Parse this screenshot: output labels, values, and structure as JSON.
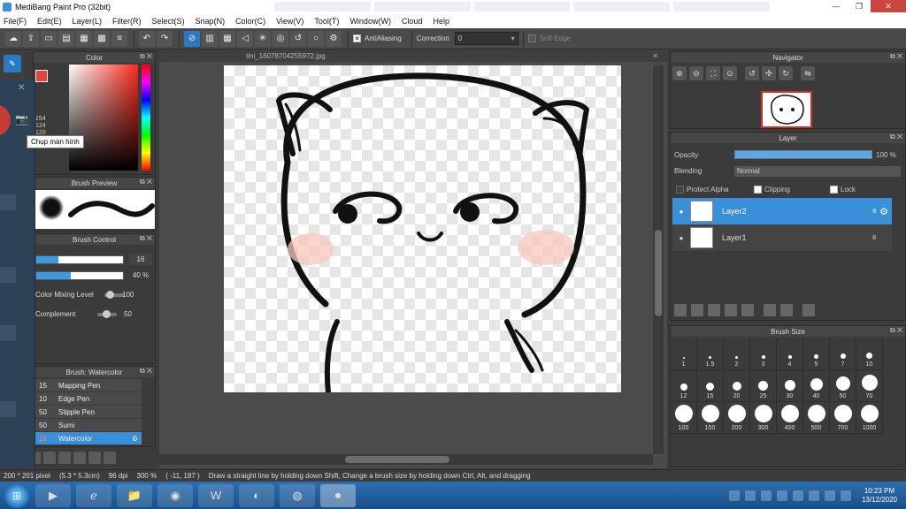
{
  "window": {
    "title": "MediBang Paint Pro (32bit)"
  },
  "menu": [
    "File(F)",
    "Edit(E)",
    "Layer(L)",
    "Filter(R)",
    "Select(S)",
    "Snap(N)",
    "Color(C)",
    "View(V)",
    "Tool(T)",
    "Window(W)",
    "Cloud",
    "Help"
  ],
  "toolbar": {
    "antialiasing_label": "AntiAliasing",
    "correction_label": "Correction",
    "correction_value": "0",
    "soft_edge_label": "Soft Edge"
  },
  "capture": {
    "tooltip": "Chụp màn hình"
  },
  "color_panel": {
    "title": "Color",
    "primary_color": "#e8423a",
    "rgb_values": [
      "154",
      "124",
      "120"
    ]
  },
  "brush_preview": {
    "title": "Brush Preview"
  },
  "brush_control": {
    "title": "Brush Control",
    "size_value": "16",
    "opacity_value": "40 %",
    "opacity_fraction": 0.4,
    "color_mixing_label": "Color Mixing Level",
    "color_mixing_value": "100",
    "complement_label": "Complement",
    "complement_value": "50"
  },
  "brush_list": {
    "title": "Brush: Watercolor",
    "items": [
      {
        "size": "15",
        "name": "Mapping Pen"
      },
      {
        "size": "10",
        "name": "Edge Pen"
      },
      {
        "size": "50",
        "name": "Stipple Pen"
      },
      {
        "size": "50",
        "name": "Sumi"
      },
      {
        "size": "16",
        "name": "Watercolor",
        "selected": true
      }
    ]
  },
  "document": {
    "tab_name": "tini_16078704255972.jpg"
  },
  "navigator": {
    "title": "Navigator"
  },
  "layer_panel": {
    "title": "Layer",
    "opacity_label": "Opacity",
    "opacity_value": "100 %",
    "blending_label": "Blending",
    "blending_value": "Normal",
    "protect_alpha_label": "Protect Alpha",
    "clipping_label": "Clipping",
    "lock_label": "Lock",
    "layers": [
      {
        "name": "Layer2",
        "badge": "8",
        "selected": true
      },
      {
        "name": "Layer1",
        "badge": "8",
        "selected": false
      }
    ]
  },
  "brush_size": {
    "title": "Brush Size",
    "sizes": [
      "1",
      "1.5",
      "2",
      "3",
      "4",
      "5",
      "7",
      "10",
      "12",
      "15",
      "20",
      "25",
      "30",
      "40",
      "50",
      "70",
      "100",
      "150",
      "200",
      "300",
      "400",
      "500",
      "700",
      "1000"
    ]
  },
  "status": {
    "dimensions": "200 * 201 pixel",
    "physical": "(5.3 * 5.3cm)",
    "dpi": "96 dpi",
    "zoom": "300 %",
    "coords": "( -11, 187 )",
    "hint": "Draw a straight line by holding down Shift, Change a brush size by holding down Ctrl, Alt, and dragging"
  },
  "taskbar": {
    "time": "10:23 PM",
    "date": "13/12/2020"
  }
}
